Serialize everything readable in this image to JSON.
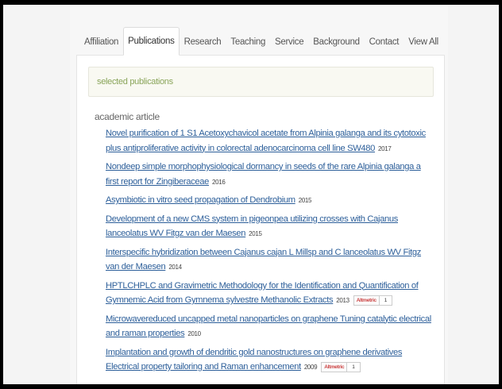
{
  "tabs": [
    {
      "label": "Affiliation"
    },
    {
      "label": "Publications"
    },
    {
      "label": "Research"
    },
    {
      "label": "Teaching"
    },
    {
      "label": "Service"
    },
    {
      "label": "Background"
    },
    {
      "label": "Contact"
    },
    {
      "label": "View All"
    }
  ],
  "active_tab": "Publications",
  "section": {
    "heading": "selected publications",
    "subheading": "academic article"
  },
  "publications": [
    {
      "title": "Novel purification of 1 S1 Acetoxychavicol acetate from Alpinia galanga and its cytotoxic plus antiproliferative activity in colorectal adenocarcinoma cell line SW480",
      "year": "2017"
    },
    {
      "title": "Nondeep simple morphophysiological dormancy in seeds of the rare Alpinia galanga a first report for Zingiberaceae",
      "year": "2016"
    },
    {
      "title": "Asymbiotic in vitro seed propagation of Dendrobium",
      "year": "2015"
    },
    {
      "title": "Development of a new CMS system in pigeonpea utilizing crosses with Cajanus lanceolatus WV Fitgz van der Maesen",
      "year": "2015"
    },
    {
      "title": "Interspecific hybridization between Cajanus cajan L Millsp and C lanceolatus WV Fitgz van der Maesen",
      "year": "2014"
    },
    {
      "title": "HPTLCHPLC and Gravimetric Methodology for the Identification and Quantification of Gymnemic Acid from Gymnema sylvestre Methanolic Extracts",
      "year": "2013",
      "altmetric": {
        "logo": "Altmetric",
        "score": "1"
      }
    },
    {
      "title": "Microwavereduced uncapped metal nanoparticles on graphene Tuning catalytic electrical and raman properties",
      "year": "2010"
    },
    {
      "title": "Implantation and growth of dendritic gold nanostructures on graphene derivatives Electrical property tailoring and Raman enhancement",
      "year": "2009",
      "altmetric": {
        "logo": "Altmetric",
        "score": "1"
      }
    }
  ]
}
